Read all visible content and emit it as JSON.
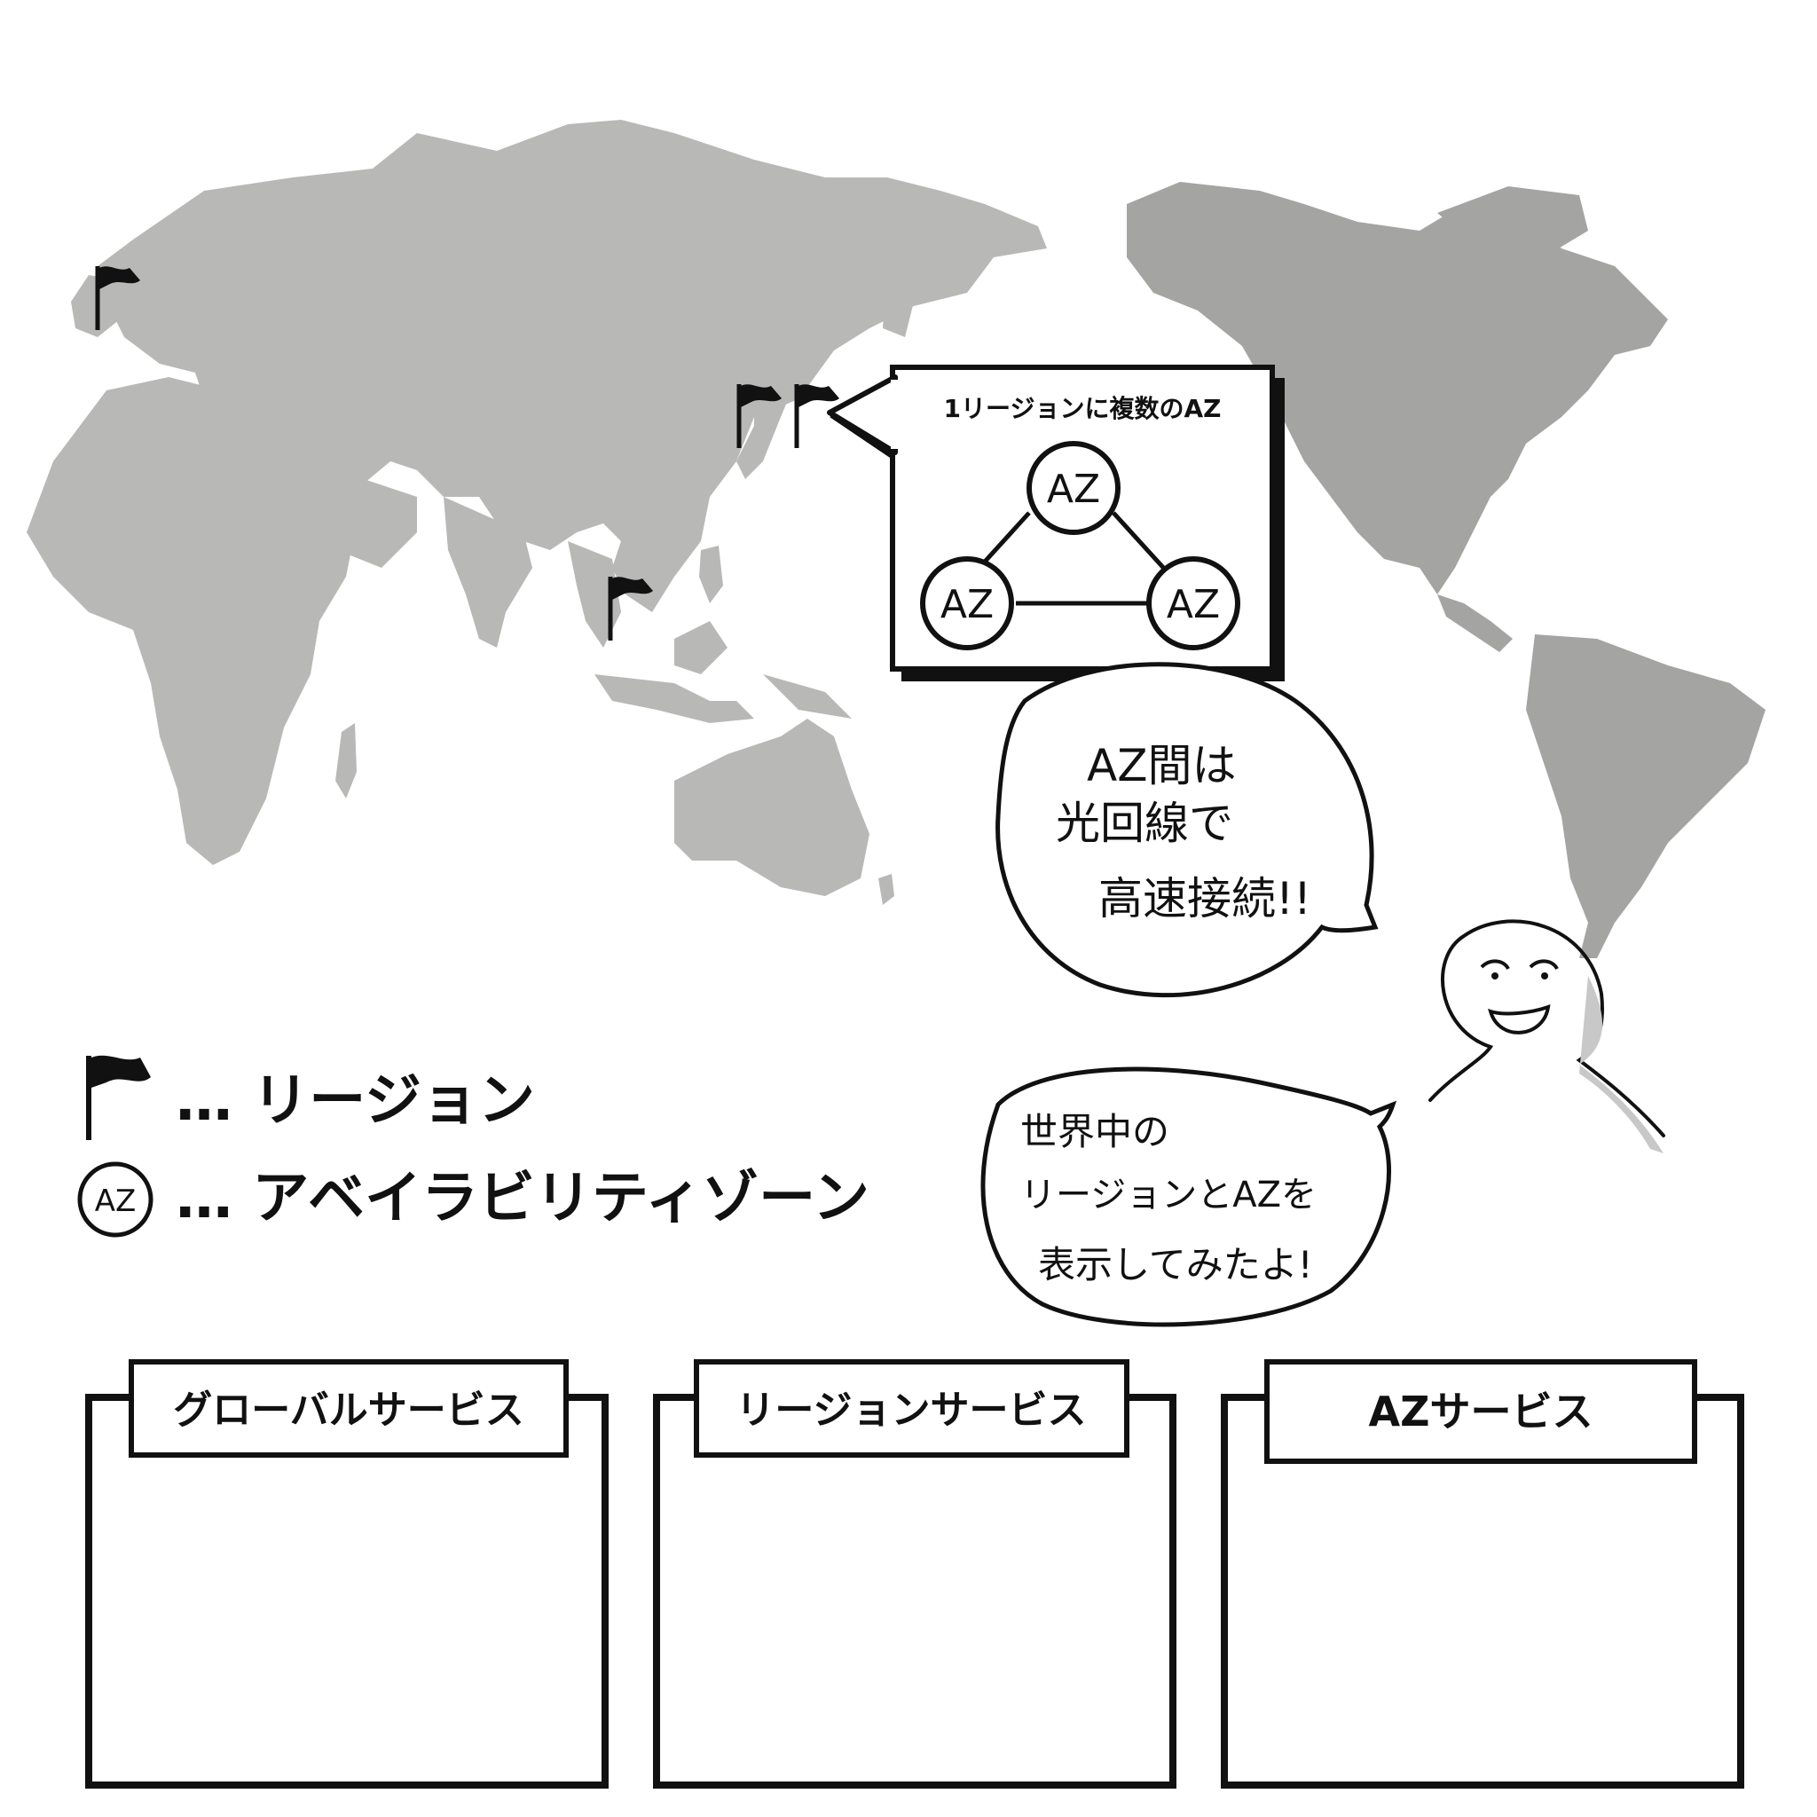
{
  "callout": {
    "title": "1リージョンに複数のAZ",
    "nodes": [
      "AZ",
      "AZ",
      "AZ"
    ]
  },
  "speech_top": {
    "lines": [
      "AZ間は",
      "光回線で",
      "高速接続!!"
    ]
  },
  "speech_bottom": {
    "lines": [
      "世界中の",
      "リージョンとAZを",
      "表示してみたよ!"
    ]
  },
  "legend": {
    "region_label": "… リージョン",
    "az_icon_text": "AZ",
    "az_label": "… アベイラビリティゾーン"
  },
  "panels": [
    {
      "title": "グローバルサービス"
    },
    {
      "title": "リージョンサービス"
    },
    {
      "title": "AZサービス"
    }
  ],
  "colors": {
    "land_old_world": "#b8b8b6",
    "land_americas": "#a4a4a2",
    "ink": "#111111"
  }
}
